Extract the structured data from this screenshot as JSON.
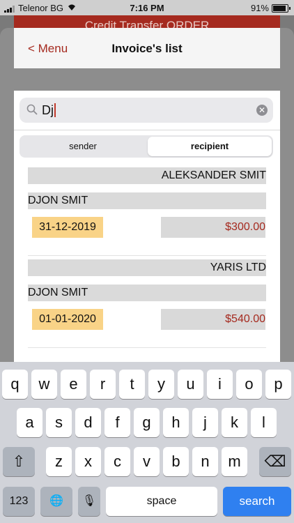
{
  "status": {
    "carrier": "Telenor BG",
    "time": "7:16 PM",
    "battery_pct": "91%",
    "battery_level": 0.91
  },
  "background_title": "Credit Transfer ORDER",
  "nav": {
    "back_label": "< Menu",
    "title": "Invoice's list"
  },
  "search": {
    "value": "Dj"
  },
  "segment": {
    "options": [
      "sender",
      "recipient"
    ],
    "selected": "recipient"
  },
  "invoices": [
    {
      "sender": "ALEKSANDER SMIT",
      "recipient": "DJON SMIT",
      "date": "31-12-2019",
      "amount": "$300.00"
    },
    {
      "sender": "YARIS LTD",
      "recipient": "DJON SMIT",
      "date": "01-01-2020",
      "amount": "$540.00"
    }
  ],
  "keyboard": {
    "row1": [
      "q",
      "w",
      "e",
      "r",
      "t",
      "y",
      "u",
      "i",
      "o",
      "p"
    ],
    "row2": [
      "a",
      "s",
      "d",
      "f",
      "g",
      "h",
      "j",
      "k",
      "l"
    ],
    "row3": [
      "z",
      "x",
      "c",
      "v",
      "b",
      "n",
      "m"
    ],
    "numbers_label": "123",
    "space_label": "space",
    "search_label": "search",
    "shift_icon": "⇧",
    "delete_icon": "⌫",
    "globe_icon": "🌐",
    "mic_icon": "🎙"
  },
  "colors": {
    "accent": "#a52a1f",
    "date_bg": "#f9d387",
    "search_key": "#2f80f0"
  }
}
